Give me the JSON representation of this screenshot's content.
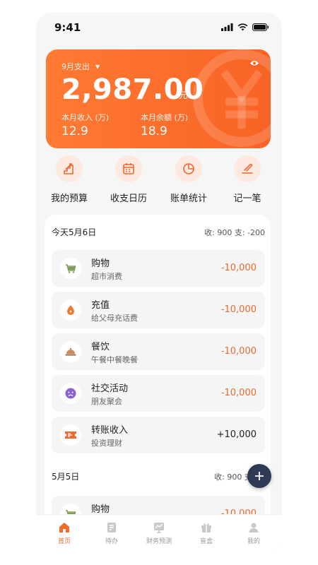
{
  "status_bar": {
    "time": "9:41"
  },
  "summary": {
    "month_label": "9月支出",
    "amount": "2,987.00",
    "unit": "元",
    "income_label": "本月收入 (万)",
    "income_value": "12.9",
    "balance_label": "本月余额 (万)",
    "balance_value": "18.9",
    "accent": "#f86325"
  },
  "actions": [
    {
      "label": "我的预算",
      "icon": "budget-icon"
    },
    {
      "label": "收支日历",
      "icon": "calendar-icon"
    },
    {
      "label": "账单统计",
      "icon": "pie-chart-icon"
    },
    {
      "label": "记一笔",
      "icon": "pen-icon"
    }
  ],
  "days": [
    {
      "date": "今天5月6日",
      "summary": "收: 900  支: -200",
      "items": [
        {
          "title": "购物",
          "subtitle": "超市消费",
          "amount": "-10,000",
          "icon": "cart-icon"
        },
        {
          "title": "充值",
          "subtitle": "给父母充话费",
          "amount": "-10,000",
          "icon": "drop-icon"
        },
        {
          "title": "餐饮",
          "subtitle": "午餐中餐晚餐",
          "amount": "-10,000",
          "icon": "cloche-icon"
        },
        {
          "title": "社交活动",
          "subtitle": "朋友聚会",
          "amount": "-10,000",
          "icon": "face-icon"
        },
        {
          "title": "转账收入",
          "subtitle": "投资理财",
          "amount": "+10,000",
          "icon": "ticket-icon"
        }
      ]
    },
    {
      "date": "5月5日",
      "summary": "收: 900  支: -2",
      "items": [
        {
          "title": "购物",
          "subtitle": "",
          "amount": "-10,000",
          "icon": "cart-icon"
        }
      ]
    }
  ],
  "tabs": [
    {
      "label": "首页",
      "icon": "home-icon",
      "active": true
    },
    {
      "label": "待办",
      "icon": "todo-icon",
      "active": false
    },
    {
      "label": "财务预测",
      "icon": "forecast-icon",
      "active": false
    },
    {
      "label": "盲盒",
      "icon": "gift-box-icon",
      "active": false
    },
    {
      "label": "我的",
      "icon": "user-icon",
      "active": false
    }
  ]
}
